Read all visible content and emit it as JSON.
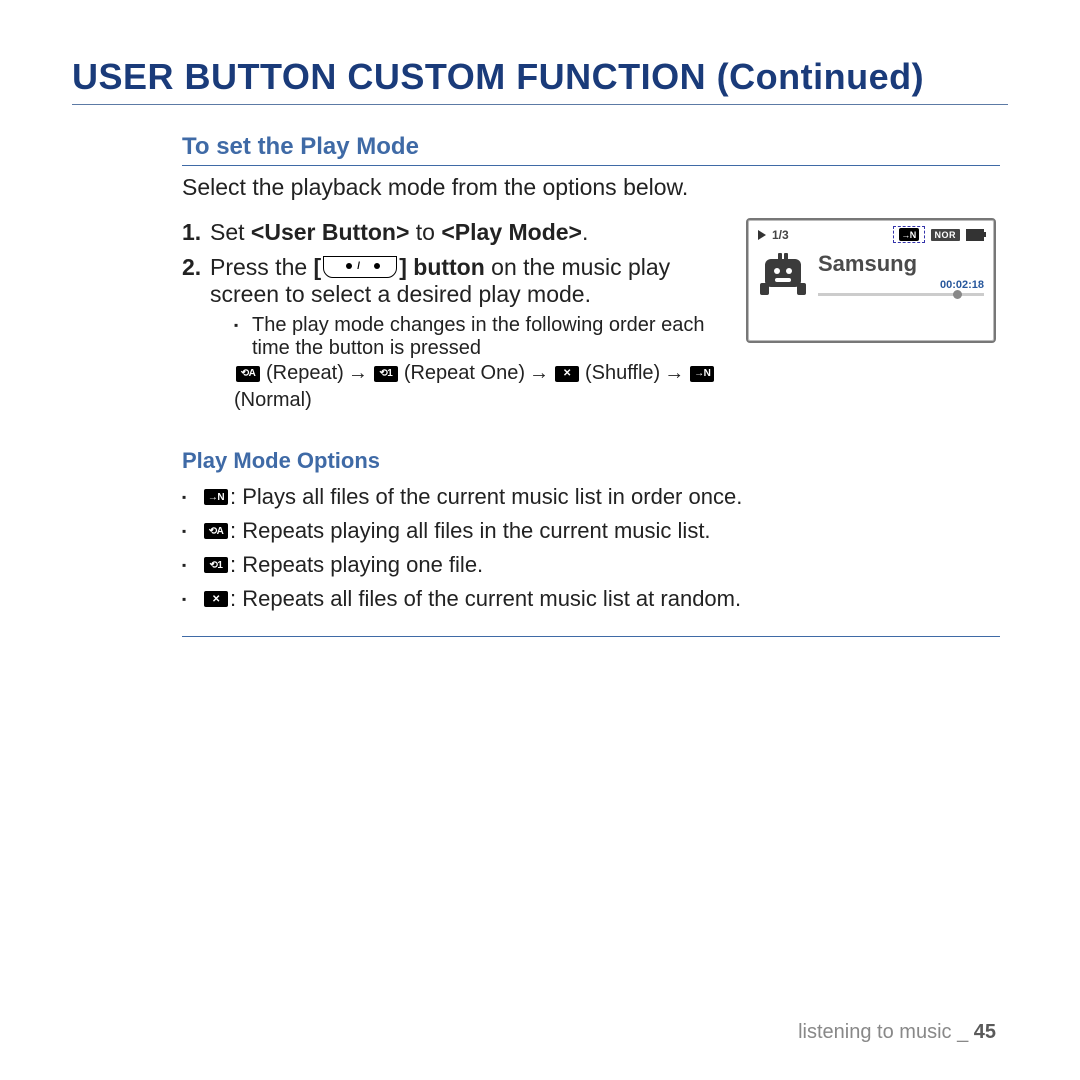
{
  "title": "USER BUTTON CUSTOM FUNCTION (Continued)",
  "section": {
    "heading": "To set the Play Mode",
    "intro": "Select the playback mode from the options below.",
    "steps": [
      {
        "num": "1.",
        "text_before": "Set ",
        "bold1": "<User Button>",
        "mid": " to ",
        "bold2": "<Play Mode>",
        "after": "."
      },
      {
        "num": "2.",
        "text_before": "Press the ",
        "bold1_before": "[",
        "bold1_after": "] button",
        "cont": " on the music play screen to select a desired play mode."
      }
    ],
    "sub_bullet": "The play mode changes in the following order each time the button is pressed",
    "chain_labels": {
      "repeat": "(Repeat)",
      "repeat_one": "(Repeat One)",
      "shuffle": "(Shuffle)",
      "normal": "(Normal)"
    }
  },
  "options": {
    "heading": "Play Mode Options",
    "items": [
      " : Plays all files of the current music list in order once.",
      " : Repeats playing all files in the current music list.",
      " : Repeats playing one file.",
      " : Repeats all files of the current music list at random."
    ]
  },
  "device": {
    "counter": "1/3",
    "nor": "NOR",
    "track": "Samsung",
    "time": "00:02:18"
  },
  "footer": {
    "label": "listening to music _ ",
    "page": "45"
  },
  "icons": {
    "normal": "→N",
    "repeat_all": "⟲A",
    "repeat_one": "⟲1",
    "shuffle": "✕"
  },
  "arrow": "→"
}
